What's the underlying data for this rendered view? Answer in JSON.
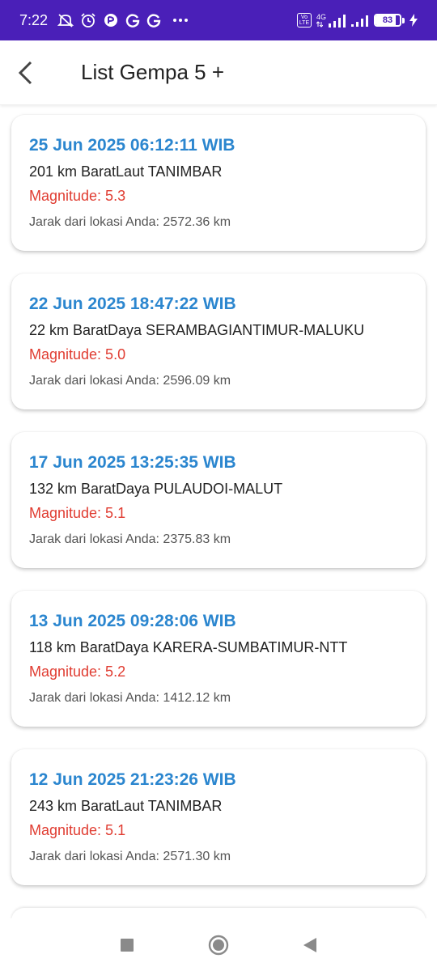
{
  "status_bar": {
    "time": "7:22",
    "icons": [
      "mute-icon",
      "alarm-icon",
      "app-icon",
      "google-icon",
      "google-icon",
      "more-icon"
    ],
    "volte_label": "Vo LTE",
    "network_type": "4G",
    "battery_level": "83",
    "battery_fraction": 0.83
  },
  "app_bar": {
    "back_icon": "back-arrow-icon",
    "title": "List Gempa 5 +"
  },
  "earthquakes": [
    {
      "date": "25 Jun 2025 06:12:11 WIB",
      "location": "201 km BaratLaut TANIMBAR",
      "magnitude": "Magnitude: 5.3",
      "distance": "Jarak dari lokasi Anda: 2572.36 km"
    },
    {
      "date": "22 Jun 2025 18:47:22 WIB",
      "location": "22 km BaratDaya SERAMBAGIANTIMUR-MALUKU",
      "magnitude": "Magnitude: 5.0",
      "distance": "Jarak dari lokasi Anda: 2596.09 km"
    },
    {
      "date": "17 Jun 2025 13:25:35 WIB",
      "location": "132 km BaratDaya PULAUDOI-MALUT",
      "magnitude": "Magnitude: 5.1",
      "distance": "Jarak dari lokasi Anda: 2375.83 km"
    },
    {
      "date": "13 Jun 2025 09:28:06 WIB",
      "location": "118 km BaratDaya KARERA-SUMBATIMUR-NTT",
      "magnitude": "Magnitude: 5.2",
      "distance": "Jarak dari lokasi Anda: 1412.12 km"
    },
    {
      "date": "12 Jun 2025 21:23:26 WIB",
      "location": "243 km BaratLaut TANIMBAR",
      "magnitude": "Magnitude: 5.1",
      "distance": "Jarak dari lokasi Anda: 2571.30 km"
    }
  ],
  "colors": {
    "status_bar": "#4a1fb8",
    "date_text": "#2b86cf",
    "magnitude_text": "#e03c31"
  },
  "nav_bar": {
    "icons": [
      "recent-apps-icon",
      "home-icon",
      "back-icon"
    ]
  }
}
